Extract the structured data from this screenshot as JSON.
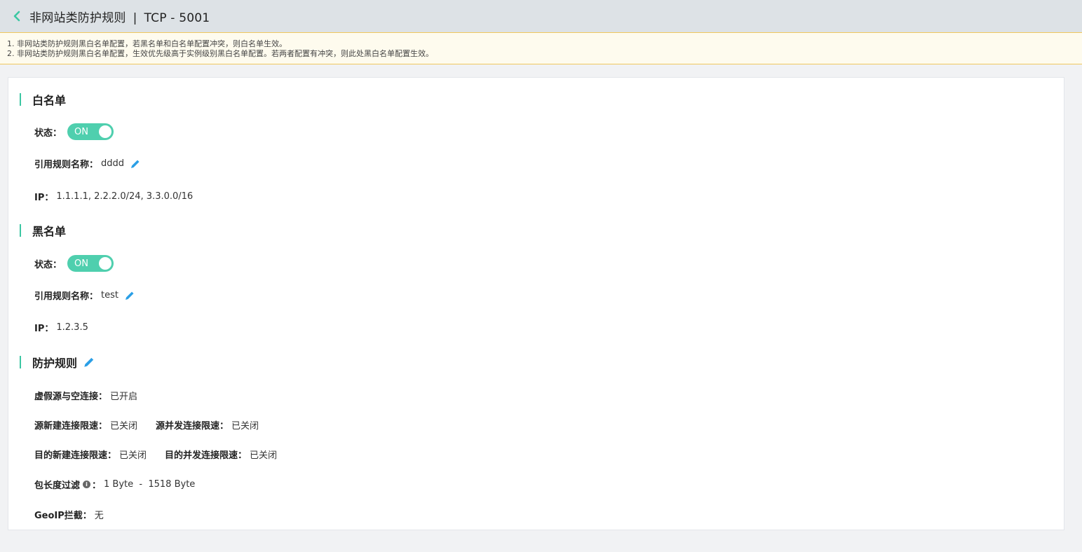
{
  "header": {
    "title": "非网站类防护规则",
    "separator": "|",
    "subtitle": "TCP - 5001"
  },
  "notice": {
    "lines": [
      "1. 非网站类防护规则黑白名单配置，若黑名单和白名单配置冲突，则白名单生效。",
      "2. 非网站类防护规则黑白名单配置，生效优先级高于实例级别黑白名单配置。若两者配置有冲突，则此处黑白名单配置生效。"
    ]
  },
  "whitelist": {
    "title": "白名单",
    "status_label": "状态：",
    "status_value": "ON",
    "rule_label": "引用规则名称：",
    "rule_value": "dddd",
    "ip_label": "IP：",
    "ip_value": "1.1.1.1, 2.2.2.0/24, 3.3.0.0/16"
  },
  "blacklist": {
    "title": "黑名单",
    "status_label": "状态：",
    "status_value": "ON",
    "rule_label": "引用规则名称：",
    "rule_value": "test",
    "ip_label": "IP：",
    "ip_value": "1.2.3.5"
  },
  "protection": {
    "title": "防护规则",
    "spoof_label": "虚假源与空连接：",
    "spoof_value": "已开启",
    "src_new_label": "源新建连接限速：",
    "src_new_value": "已关闭",
    "src_conc_label": "源并发连接限速：",
    "src_conc_value": "已关闭",
    "dst_new_label": "目的新建连接限速：",
    "dst_new_value": "已关闭",
    "dst_conc_label": "目的并发连接限速：",
    "dst_conc_value": "已关闭",
    "pkt_label": "包长度过滤",
    "pkt_colon": "：",
    "pkt_value": "1 Byte  -  1518 Byte",
    "geo_label": "GeoIP拦截：",
    "geo_value": "无"
  },
  "colors": {
    "accent": "#3cc7a3",
    "toggle": "#4fcfae",
    "edit_icon": "#2b9fe6",
    "notice_border": "#f0c75e"
  },
  "icons": [
    "chevron-left-icon",
    "pencil-icon",
    "info-icon"
  ]
}
